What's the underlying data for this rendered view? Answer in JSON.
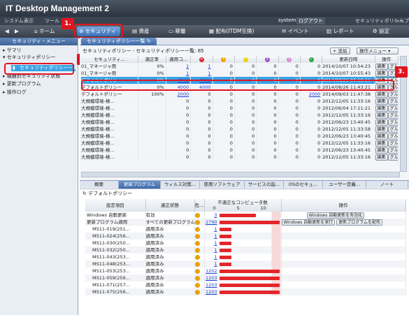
{
  "app": {
    "title": "IT Desktop Management 2"
  },
  "menu": {
    "items": [
      "システム",
      "表示",
      "ツール"
    ],
    "user_label": "system",
    "logout": "ログアウト",
    "policy": "セキュリティポリシー",
    "help": "ヘルプ"
  },
  "toolbar": {
    "home": "ホーム",
    "security": "セキュリティ",
    "assets": "資産",
    "operation": "稼働",
    "distribution": "配布(ITDM互換)",
    "events": "イベント",
    "reports": "レポート",
    "settings": "設定"
  },
  "callouts": {
    "one": "1.",
    "two": "2.",
    "three": "3."
  },
  "sidebar": {
    "header": "セキュリティ・メニュー",
    "items": [
      "サマリ",
      "セキュリティポリシー",
      "セキュリティポリシー一覧",
      "機器別セキュリティ状態",
      "更新プログラム",
      "操作ログ"
    ]
  },
  "main": {
    "tab": "セキュリティポリシー一覧",
    "breadcrumb": "セキュリティポリシー - セキュリティポリシー一覧: 85",
    "add_button": "+ 追加",
    "ops_button": "操作メニュー",
    "columns": [
      "セキュリティ...",
      "適正率",
      "適用コ...",
      "✕",
      "!",
      "!",
      "?",
      "?",
      "✓",
      "更新日時",
      "操作"
    ],
    "edit": "編集",
    "group": "グルー",
    "rows": [
      [
        "01_マネージャ用",
        "0%",
        "1",
        "1",
        "0",
        "0",
        "0",
        "0",
        "0",
        "2014/10/07 10:54:23"
      ],
      [
        "01_マネージャ用",
        "0%",
        "1",
        "1",
        "0",
        "0",
        "0",
        "0",
        "0",
        "2014/10/07 10:55:43"
      ],
      [
        "デフォルトポリシー",
        "0%",
        "4002",
        "4002",
        "0",
        "0",
        "0",
        "0",
        "0",
        "2014/08/26 09:18:16"
      ],
      [
        "デフォルトポリシー",
        "0%",
        "4000",
        "4000",
        "0",
        "0",
        "0",
        "0",
        "0",
        "2014/08/26 11:43:21"
      ],
      [
        "デフォルトポリシー",
        "100%",
        "2000",
        "0",
        "0",
        "0",
        "0",
        "0",
        "2000",
        "2014/09/03 11:47:38"
      ],
      [
        "大規模環境-検...",
        "",
        "0",
        "0",
        "0",
        "0",
        "0",
        "0",
        "0",
        "2012/12/05 11:33:16"
      ],
      [
        "大規模環境-検...",
        "",
        "0",
        "0",
        "0",
        "0",
        "0",
        "0",
        "0",
        "2012/06/04 17:11:21"
      ],
      [
        "大規模環境-検...",
        "",
        "0",
        "0",
        "0",
        "0",
        "0",
        "0",
        "0",
        "2012/12/05 11:33:16"
      ],
      [
        "大規模環境-検...",
        "",
        "0",
        "0",
        "0",
        "0",
        "0",
        "0",
        "0",
        "2012/06/23 13:40:45"
      ],
      [
        "大規模環境-検...",
        "",
        "0",
        "0",
        "0",
        "0",
        "0",
        "0",
        "0",
        "2012/12/05 11:33:58"
      ],
      [
        "大規模環境-検...",
        "",
        "0",
        "0",
        "0",
        "0",
        "0",
        "0",
        "0",
        "2012/06/23 13:40:45"
      ],
      [
        "大規模環境-検...",
        "",
        "0",
        "0",
        "0",
        "0",
        "0",
        "0",
        "0",
        "2012/12/05 11:33:16"
      ],
      [
        "大規模環境-検...",
        "",
        "0",
        "0",
        "0",
        "0",
        "0",
        "0",
        "0",
        "2012/06/23 13:40:45"
      ],
      [
        "大規模環境-検...",
        "",
        "0",
        "0",
        "0",
        "0",
        "0",
        "0",
        "0",
        "2012/12/05 11:33:16"
      ]
    ]
  },
  "subtabs": [
    "概要",
    "更新プログラム",
    "ウィルス対策...",
    "使用ソフトウェア",
    "サービスの起...",
    "OSのセキュ...",
    "ユーザー定義...",
    "ノート"
  ],
  "detail": {
    "title": "デフォルトポリシー",
    "columns": [
      "設定項目",
      "適正状態",
      "危...",
      "不適正なコンピュータ数",
      "操作"
    ],
    "scale": [
      "0",
      "5",
      "10"
    ],
    "btn_auto": "Windows 自動更新を有効化",
    "btn_run": "Windows 自動更新を実行",
    "btn_dist": "更新プログラムを配布",
    "rows": [
      {
        "item": "Windows 自動更新",
        "state": "有効",
        "count": "3",
        "bar": 0.6
      },
      {
        "item": "更新プログラム適用",
        "state": "すべての更新プログラム...",
        "count": "2790",
        "bar": 1
      },
      {
        "item": "MS11-019(251...",
        "state": "適用済み",
        "count": "1",
        "bar": 0.2
      },
      {
        "item": "MS11-024(256...",
        "state": "適用済み",
        "count": "1",
        "bar": 0.2
      },
      {
        "item": "MS11-030(250...",
        "state": "適用済み",
        "count": "1",
        "bar": 0.2
      },
      {
        "item": "MS11-032(250...",
        "state": "適用済み",
        "count": "1",
        "bar": 0.2
      },
      {
        "item": "MS11-043(253...",
        "state": "適用済み",
        "count": "1",
        "bar": 0.2
      },
      {
        "item": "MS11-048(253...",
        "state": "適用済み",
        "count": "1",
        "bar": 0.2
      },
      {
        "item": "MS11-053(253...",
        "state": "適用済み",
        "count": "1202",
        "bar": 1
      },
      {
        "item": "MS11-059(256...",
        "state": "適用済み",
        "count": "1203",
        "bar": 1
      },
      {
        "item": "MS11-071(257...",
        "state": "適用済み",
        "count": "1203",
        "bar": 1
      },
      {
        "item": "MS11-075(256...",
        "state": "適用済み",
        "count": "1203",
        "bar": 1
      }
    ]
  }
}
